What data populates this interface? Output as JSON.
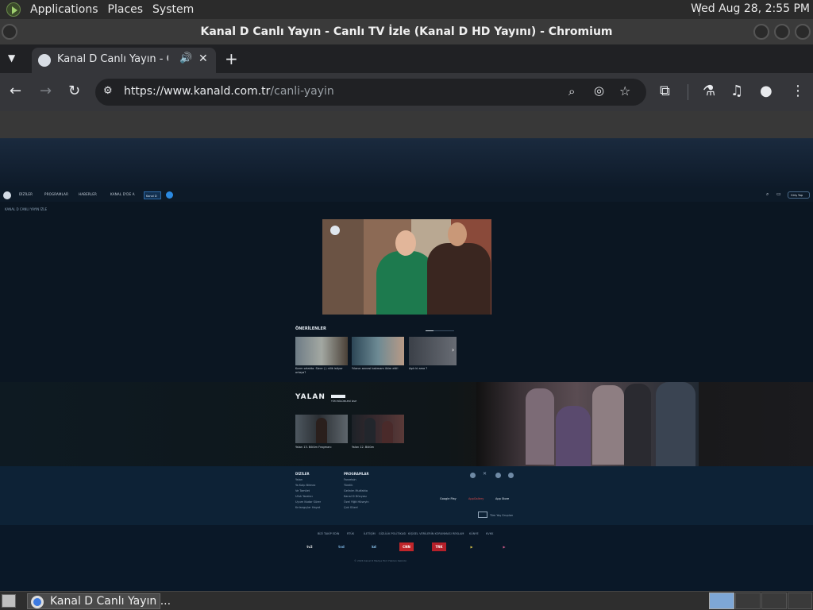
{
  "panel": {
    "menus": [
      "Applications",
      "Places",
      "System"
    ],
    "clock": "Wed Aug 28,  2:55 PM"
  },
  "window": {
    "title": "Kanal D Canlı Yayın - Canlı TV İzle (Kanal D HD Yayını) - Chromium"
  },
  "tabs": {
    "active_title": "Kanal D Canlı Yayın - Canlı TV İzle (Kanal D HD Yayını)",
    "audio_icon": "speaker-icon",
    "close_icon": "close-icon",
    "new_tab_icon": "plus-icon"
  },
  "toolbar": {
    "url_host": "https://www.kanald.com.tr",
    "url_path": "/canli-yayin",
    "icons": [
      "back-icon",
      "forward-icon",
      "reload-icon",
      "site-info-icon",
      "zoom-icon",
      "eye-off-icon",
      "star-icon",
      "extensions-icon",
      "labs-icon",
      "media-icon",
      "profile-icon",
      "menu-icon"
    ]
  },
  "site": {
    "nav": [
      "DİZİLER",
      "PROGRAMLAR",
      "HABERLER",
      "KANAL D'DE A"
    ],
    "live_label": "Kanal D",
    "breadcrumb": "KANAL D CANLI YAYIN İZLE",
    "search_label": "Giriş Yap",
    "recommended_title": "ÖNERİLENLER",
    "recommended": [
      {
        "caption": "Kızım ortakta. Sizce ( ) nilik istiyor ortaya?"
      },
      {
        "caption": "Yılanın annesi bakmam ilkim etti!"
      },
      {
        "caption": "Aşık ki ama ?"
      }
    ],
    "show_title": "YALAN",
    "show_badge": "TÜM BÖLÜMLERİ İZLE",
    "episodes": [
      {
        "caption": "Yalan 13. Bölüm Fragmanı"
      },
      {
        "caption": "Yalan 12. Bölüm"
      }
    ],
    "footer": {
      "col1_title": "DİZİLER",
      "col1_items": [
        "Yalan",
        "Ya Kalp Bilmez",
        "Ve Tamilet",
        "Ufuk Yaratıcı",
        "Uyum Kadar Sürer",
        "Kırlangıçlar Hayat"
      ],
      "col2_title": "PROGRAMLAR",
      "col2_items": [
        "Farzetsin",
        "Türelik",
        "Gelinim Mutfakta",
        "Kanal D Dünyası",
        "Özel Yiğit Hüseyin",
        "Çok Güzel"
      ],
      "stores": [
        "Google Play",
        "AppGallery",
        "App Store"
      ],
      "age_label": "Tüm Yaş Grupları",
      "bottom_links": [
        "BİZİ TAKİP EDİN",
        "RTÜK",
        "İLETİŞİM",
        "GİZLİLİK POLİTİKASI",
        "KİŞİSEL VERİLERİN KORUNMASI",
        "REKLAM",
        "KÜNYE",
        "KVKK"
      ],
      "channels": [
        "tv2",
        "tvd",
        "kd",
        "CNN",
        "TRK",
        "▶",
        "▶"
      ],
      "copyright": "© 2024 Kanal D Medya Tüm Hakları Saklıdır."
    }
  },
  "taskbar": {
    "window_label": "Kanal D Canlı Yayın ..."
  }
}
